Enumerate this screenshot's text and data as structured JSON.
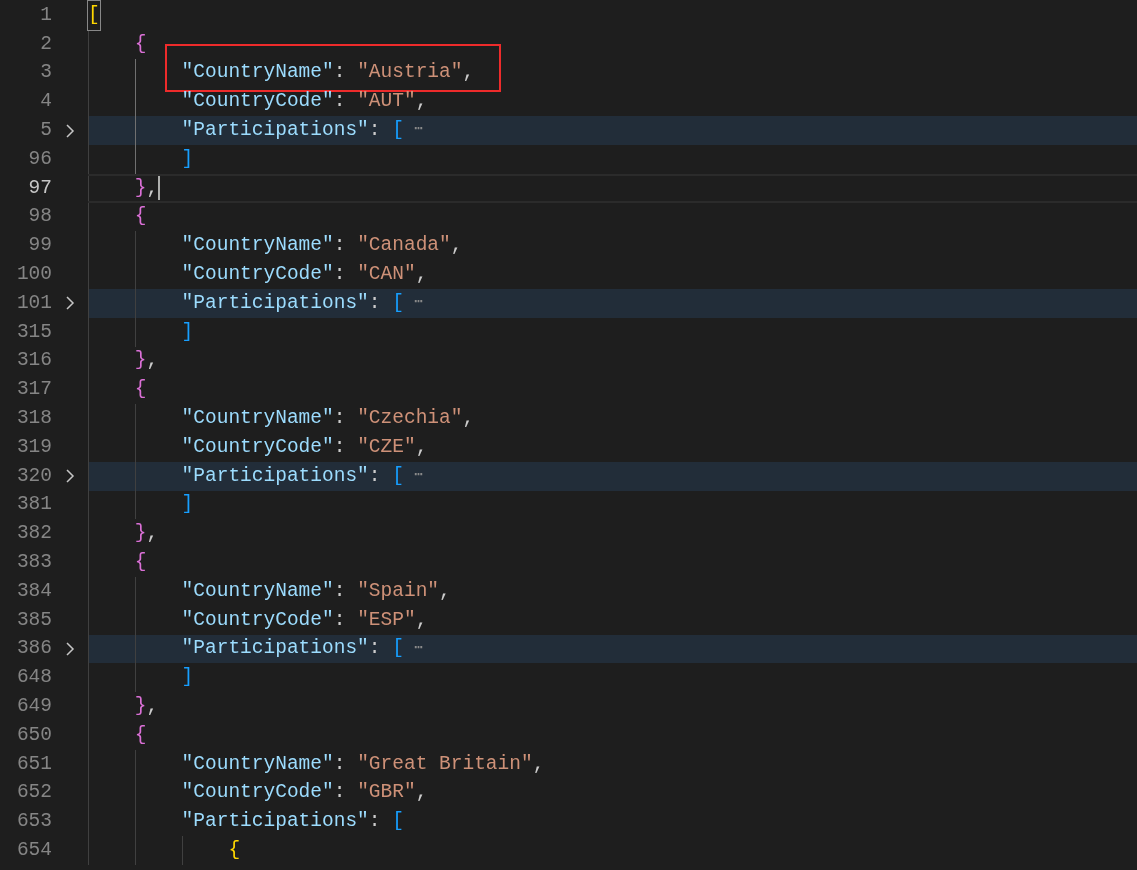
{
  "editor": {
    "lines": [
      {
        "number": "1",
        "folded": false,
        "current": false,
        "boxed": false,
        "tokens": [
          {
            "kind": "bracket-gold",
            "text": "[",
            "matched": true
          }
        ]
      },
      {
        "number": "2",
        "guides": [
          {
            "active": false
          }
        ],
        "folded": false,
        "current": false,
        "boxed": false,
        "tokens": [
          {
            "kind": "bracket-purple",
            "text": "{"
          }
        ]
      },
      {
        "number": "3",
        "guides": [
          {
            "active": false
          },
          {
            "active": true
          }
        ],
        "folded": false,
        "current": false,
        "boxed": true,
        "tokens": [
          {
            "kind": "key",
            "text": "\"CountryName\""
          },
          {
            "kind": "punct",
            "text": ": "
          },
          {
            "kind": "string",
            "text": "\"Austria\""
          },
          {
            "kind": "punct",
            "text": ","
          }
        ]
      },
      {
        "number": "4",
        "guides": [
          {
            "active": false
          },
          {
            "active": true
          }
        ],
        "folded": false,
        "current": false,
        "boxed": false,
        "tokens": [
          {
            "kind": "key",
            "text": "\"CountryCode\""
          },
          {
            "kind": "punct",
            "text": ": "
          },
          {
            "kind": "string",
            "text": "\"AUT\""
          },
          {
            "kind": "punct",
            "text": ","
          }
        ]
      },
      {
        "number": "5",
        "guides": [
          {
            "active": false
          },
          {
            "active": true
          }
        ],
        "folded": true,
        "current": false,
        "boxed": false,
        "tokens": [
          {
            "kind": "key",
            "text": "\"Participations\""
          },
          {
            "kind": "punct",
            "text": ": "
          },
          {
            "kind": "bracket-blue",
            "text": "["
          },
          {
            "kind": "ellipsis",
            "text": "⋯"
          }
        ]
      },
      {
        "number": "96",
        "guides": [
          {
            "active": false
          },
          {
            "active": true
          }
        ],
        "folded": false,
        "current": false,
        "boxed": false,
        "tokens": [
          {
            "kind": "bracket-blue",
            "text": "]"
          }
        ]
      },
      {
        "number": "97",
        "guides": [
          {
            "active": false
          }
        ],
        "folded": false,
        "current": true,
        "boxed": false,
        "tokens": [
          {
            "kind": "bracket-purple",
            "text": "}"
          },
          {
            "kind": "punct",
            "text": ","
          }
        ]
      },
      {
        "number": "98",
        "guides": [
          {
            "active": false
          }
        ],
        "folded": false,
        "current": false,
        "boxed": false,
        "tokens": [
          {
            "kind": "bracket-purple",
            "text": "{"
          }
        ]
      },
      {
        "number": "99",
        "guides": [
          {
            "active": false
          },
          {
            "active": false
          }
        ],
        "folded": false,
        "current": false,
        "boxed": false,
        "tokens": [
          {
            "kind": "key",
            "text": "\"CountryName\""
          },
          {
            "kind": "punct",
            "text": ": "
          },
          {
            "kind": "string",
            "text": "\"Canada\""
          },
          {
            "kind": "punct",
            "text": ","
          }
        ]
      },
      {
        "number": "100",
        "guides": [
          {
            "active": false
          },
          {
            "active": false
          }
        ],
        "folded": false,
        "current": false,
        "boxed": false,
        "tokens": [
          {
            "kind": "key",
            "text": "\"CountryCode\""
          },
          {
            "kind": "punct",
            "text": ": "
          },
          {
            "kind": "string",
            "text": "\"CAN\""
          },
          {
            "kind": "punct",
            "text": ","
          }
        ]
      },
      {
        "number": "101",
        "guides": [
          {
            "active": false
          },
          {
            "active": false
          }
        ],
        "folded": true,
        "current": false,
        "boxed": false,
        "tokens": [
          {
            "kind": "key",
            "text": "\"Participations\""
          },
          {
            "kind": "punct",
            "text": ": "
          },
          {
            "kind": "bracket-blue",
            "text": "["
          },
          {
            "kind": "ellipsis",
            "text": "⋯"
          }
        ]
      },
      {
        "number": "315",
        "guides": [
          {
            "active": false
          },
          {
            "active": false
          }
        ],
        "folded": false,
        "current": false,
        "boxed": false,
        "tokens": [
          {
            "kind": "bracket-blue",
            "text": "]"
          }
        ]
      },
      {
        "number": "316",
        "guides": [
          {
            "active": false
          }
        ],
        "folded": false,
        "current": false,
        "boxed": false,
        "tokens": [
          {
            "kind": "bracket-purple",
            "text": "}"
          },
          {
            "kind": "punct",
            "text": ","
          }
        ]
      },
      {
        "number": "317",
        "guides": [
          {
            "active": false
          }
        ],
        "folded": false,
        "current": false,
        "boxed": false,
        "tokens": [
          {
            "kind": "bracket-purple",
            "text": "{"
          }
        ]
      },
      {
        "number": "318",
        "guides": [
          {
            "active": false
          },
          {
            "active": false
          }
        ],
        "folded": false,
        "current": false,
        "boxed": false,
        "tokens": [
          {
            "kind": "key",
            "text": "\"CountryName\""
          },
          {
            "kind": "punct",
            "text": ": "
          },
          {
            "kind": "string",
            "text": "\"Czechia\""
          },
          {
            "kind": "punct",
            "text": ","
          }
        ]
      },
      {
        "number": "319",
        "guides": [
          {
            "active": false
          },
          {
            "active": false
          }
        ],
        "folded": false,
        "current": false,
        "boxed": false,
        "tokens": [
          {
            "kind": "key",
            "text": "\"CountryCode\""
          },
          {
            "kind": "punct",
            "text": ": "
          },
          {
            "kind": "string",
            "text": "\"CZE\""
          },
          {
            "kind": "punct",
            "text": ","
          }
        ]
      },
      {
        "number": "320",
        "guides": [
          {
            "active": false
          },
          {
            "active": false
          }
        ],
        "folded": true,
        "current": false,
        "boxed": false,
        "tokens": [
          {
            "kind": "key",
            "text": "\"Participations\""
          },
          {
            "kind": "punct",
            "text": ": "
          },
          {
            "kind": "bracket-blue",
            "text": "["
          },
          {
            "kind": "ellipsis",
            "text": "⋯"
          }
        ]
      },
      {
        "number": "381",
        "guides": [
          {
            "active": false
          },
          {
            "active": false
          }
        ],
        "folded": false,
        "current": false,
        "boxed": false,
        "tokens": [
          {
            "kind": "bracket-blue",
            "text": "]"
          }
        ]
      },
      {
        "number": "382",
        "guides": [
          {
            "active": false
          }
        ],
        "folded": false,
        "current": false,
        "boxed": false,
        "tokens": [
          {
            "kind": "bracket-purple",
            "text": "}"
          },
          {
            "kind": "punct",
            "text": ","
          }
        ]
      },
      {
        "number": "383",
        "guides": [
          {
            "active": false
          }
        ],
        "folded": false,
        "current": false,
        "boxed": false,
        "tokens": [
          {
            "kind": "bracket-purple",
            "text": "{"
          }
        ]
      },
      {
        "number": "384",
        "guides": [
          {
            "active": false
          },
          {
            "active": false
          }
        ],
        "folded": false,
        "current": false,
        "boxed": false,
        "tokens": [
          {
            "kind": "key",
            "text": "\"CountryName\""
          },
          {
            "kind": "punct",
            "text": ": "
          },
          {
            "kind": "string",
            "text": "\"Spain\""
          },
          {
            "kind": "punct",
            "text": ","
          }
        ]
      },
      {
        "number": "385",
        "guides": [
          {
            "active": false
          },
          {
            "active": false
          }
        ],
        "folded": false,
        "current": false,
        "boxed": false,
        "tokens": [
          {
            "kind": "key",
            "text": "\"CountryCode\""
          },
          {
            "kind": "punct",
            "text": ": "
          },
          {
            "kind": "string",
            "text": "\"ESP\""
          },
          {
            "kind": "punct",
            "text": ","
          }
        ]
      },
      {
        "number": "386",
        "guides": [
          {
            "active": false
          },
          {
            "active": false
          }
        ],
        "folded": true,
        "current": false,
        "boxed": false,
        "tokens": [
          {
            "kind": "key",
            "text": "\"Participations\""
          },
          {
            "kind": "punct",
            "text": ": "
          },
          {
            "kind": "bracket-blue",
            "text": "["
          },
          {
            "kind": "ellipsis",
            "text": "⋯"
          }
        ]
      },
      {
        "number": "648",
        "guides": [
          {
            "active": false
          },
          {
            "active": false
          }
        ],
        "folded": false,
        "current": false,
        "boxed": false,
        "tokens": [
          {
            "kind": "bracket-blue",
            "text": "]"
          }
        ]
      },
      {
        "number": "649",
        "guides": [
          {
            "active": false
          }
        ],
        "folded": false,
        "current": false,
        "boxed": false,
        "tokens": [
          {
            "kind": "bracket-purple",
            "text": "}"
          },
          {
            "kind": "punct",
            "text": ","
          }
        ]
      },
      {
        "number": "650",
        "guides": [
          {
            "active": false
          }
        ],
        "folded": false,
        "current": false,
        "boxed": false,
        "tokens": [
          {
            "kind": "bracket-purple",
            "text": "{"
          }
        ]
      },
      {
        "number": "651",
        "guides": [
          {
            "active": false
          },
          {
            "active": false
          }
        ],
        "folded": false,
        "current": false,
        "boxed": false,
        "tokens": [
          {
            "kind": "key",
            "text": "\"CountryName\""
          },
          {
            "kind": "punct",
            "text": ": "
          },
          {
            "kind": "string",
            "text": "\"Great Britain\""
          },
          {
            "kind": "punct",
            "text": ","
          }
        ]
      },
      {
        "number": "652",
        "guides": [
          {
            "active": false
          },
          {
            "active": false
          }
        ],
        "folded": false,
        "current": false,
        "boxed": false,
        "tokens": [
          {
            "kind": "key",
            "text": "\"CountryCode\""
          },
          {
            "kind": "punct",
            "text": ": "
          },
          {
            "kind": "string",
            "text": "\"GBR\""
          },
          {
            "kind": "punct",
            "text": ","
          }
        ]
      },
      {
        "number": "653",
        "guides": [
          {
            "active": false
          },
          {
            "active": false
          }
        ],
        "folded": false,
        "current": false,
        "boxed": false,
        "tokens": [
          {
            "kind": "key",
            "text": "\"Participations\""
          },
          {
            "kind": "punct",
            "text": ": "
          },
          {
            "kind": "bracket-blue",
            "text": "["
          }
        ]
      },
      {
        "number": "654",
        "guides": [
          {
            "active": false
          },
          {
            "active": false
          },
          {
            "active": false
          }
        ],
        "folded": false,
        "current": false,
        "boxed": false,
        "tokens": [
          {
            "kind": "bracket-gold",
            "text": "{"
          }
        ]
      }
    ]
  }
}
